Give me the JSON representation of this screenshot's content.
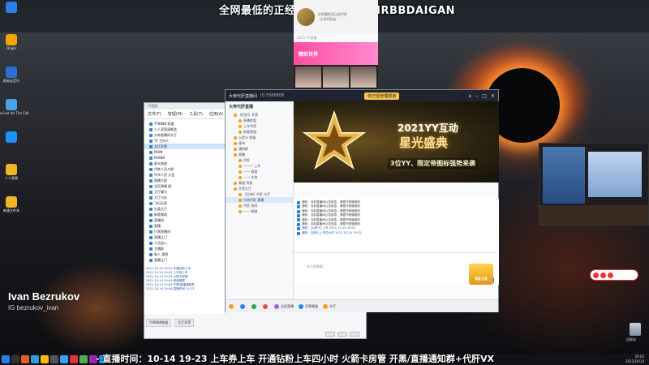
{
  "banner": {
    "text": "全网最低的正经代肝店：+VX MRBBDAIGAN"
  },
  "ticker": {
    "text": "- 直播时间：10-14 19-23 上车券上车 开通钻粉上车四小时 火箭卡房管 开黑/直播通知群+代肝VX"
  },
  "presenter": {
    "name": "Ivan Bezrukov",
    "handle": "IG bezrukov_ivan"
  },
  "desktop_icons": [
    {
      "label": "",
      "color": "#2b7de9",
      "icon": "app-icon"
    },
    {
      "label": "Origin",
      "color": "#f4a300",
      "icon": "folder-icon"
    },
    {
      "label": "网易云音乐",
      "color": "#2d6fd0",
      "icon": "app-icon"
    },
    {
      "label": "Love-Live for The Call",
      "color": "#4aa3e8",
      "icon": "app-icon"
    },
    {
      "label": "",
      "color": "#1e90ff",
      "icon": "globe-icon"
    },
    {
      "label": "人人视频",
      "color": "#f0b429",
      "icon": "folder-icon"
    },
    {
      "label": "新建文件夹",
      "color": "#f0b429",
      "icon": "folder-icon"
    }
  ],
  "phone": {
    "header_line1": "全网最低的正经代肝",
    "header_line2": "· 正经代肝店",
    "sub": "2021 YY直播",
    "promo": "精彩世界"
  },
  "qq": {
    "title": "YY团队",
    "menu": [
      "文件(F)",
      "管理(M)",
      "工具(T)",
      "应用(A)",
      "帮助(H)"
    ],
    "tree": [
      {
        "label": "YY8888 频道",
        "sel": false
      },
      {
        "label": "人人家园演唱会",
        "sel": false
      },
      {
        "label": "大帝直播间大厅",
        "sel": false
      },
      {
        "label": "YY 主持人",
        "sel": false
      },
      {
        "label": "大厅开黑",
        "sel": true
      },
      {
        "label": "MAIN",
        "sel": false
      },
      {
        "label": "MAINB",
        "sel": false
      },
      {
        "label": "星光频道",
        "sel": false
      },
      {
        "label": "代练人员大群",
        "sel": false
      },
      {
        "label": "中华人民 大会",
        "sel": false
      },
      {
        "label": "直播大群",
        "sel": false
      },
      {
        "label": "全民演唱 群",
        "sel": false
      },
      {
        "label": "大厅聊天",
        "sel": false
      },
      {
        "label": "大厅讨论",
        "sel": false
      },
      {
        "label": "飞行玩家",
        "sel": false
      },
      {
        "label": "分类大厅",
        "sel": false
      },
      {
        "label": "新版频道",
        "sel": false
      },
      {
        "label": "直播间",
        "sel": false
      },
      {
        "label": "直播",
        "sel": false
      },
      {
        "label": "日常直播间",
        "sel": false
      },
      {
        "label": "直播之门",
        "sel": false
      },
      {
        "label": "人员加入",
        "sel": false
      },
      {
        "label": "主播群",
        "sel": false
      },
      {
        "label": "新人 报到",
        "sel": false
      },
      {
        "label": "直播之门",
        "sel": false
      }
    ],
    "log": [
      "2021-10-14 19:01  开通钻粉上车 ",
      "2021-10-14 19:02  上车券上车 ",
      "2021-10-14 19:03  火箭卡房管 ",
      "2021-10-14 19:04  频道管理 ",
      "2021-10-14 19:05  开黑/直播通知群 ",
      "2021-10-14 19:06  直播时间 19-23"
    ],
    "tabs": [
      "YY8888频道",
      "大厅开黑"
    ]
  },
  "yy": {
    "title": "大帝代肝直播间",
    "channel": "ID 5588808",
    "hot_label": "你已经管理频道",
    "channel_tree_title": "大帝代肝直播",
    "channel_tree": [
      {
        "label": "【代肝】开黑",
        "sub": false,
        "sel": false
      },
      {
        "label": "直播房管",
        "sub": true,
        "sel": false
      },
      {
        "label": "上车专用",
        "sub": true,
        "sel": false
      },
      {
        "label": "房管频道",
        "sub": true,
        "sel": false
      },
      {
        "label": "火箭卡 频道",
        "sub": false,
        "sel": false
      },
      {
        "label": "接待",
        "sub": false,
        "sel": false
      },
      {
        "label": "通知群",
        "sub": false,
        "sel": false
      },
      {
        "label": "直播",
        "sub": false,
        "sel": false
      },
      {
        "label": "代肝",
        "sub": true,
        "sel": false
      },
      {
        "label": "一一一 上车",
        "sub": true,
        "sel": false
      },
      {
        "label": "—— 频道",
        "sub": true,
        "sel": false
      },
      {
        "label": "—— 主持",
        "sub": true,
        "sel": false
      },
      {
        "label": "频道 列表",
        "sub": false,
        "sel": false
      },
      {
        "label": "开黑大厅",
        "sub": false,
        "sel": false
      },
      {
        "label": "【大帝】代肝 大厅",
        "sub": true,
        "sel": false
      },
      {
        "label": "大帝代肝 直播",
        "sub": true,
        "sel": true
      },
      {
        "label": "代肝 房间",
        "sub": true,
        "sel": false
      },
      {
        "label": "—— 频道",
        "sub": true,
        "sel": false
      }
    ],
    "stage": {
      "line1": "2021YY互动",
      "line2": "星光盛典",
      "line3": "3位YY、限定帝图标强势来袭"
    },
    "chat": [
      {
        "text": "通知：当前直播间公告信息，请遵守频道规则",
        "blue": false
      },
      {
        "text": "通知：当前直播间公告信息，请遵守频道规则",
        "blue": false
      },
      {
        "text": "通知：当前直播间公告信息，请遵守频道规则",
        "blue": false
      },
      {
        "text": "通知：当前直播间公告信息，请遵守频道规则",
        "blue": false
      },
      {
        "text": "通知：当前直播间公告信息，请遵守频道规则",
        "blue": false
      },
      {
        "text": "通知：当前直播间公告信息，请遵守频道规则",
        "blue": false
      },
      {
        "text": "通知：[火箭卡] 上车 2021-10-14 19:01",
        "blue": true
      },
      {
        "text": "通知：[钻粉] 上车四小时 2021-10-14 19:02",
        "blue": true
      }
    ],
    "input_placeholder": "和大家聊聊...",
    "send_label": "发送",
    "badge_label": "领取大奖",
    "bottom": [
      {
        "label": "",
        "color": "#f0a020"
      },
      {
        "label": "",
        "color": "#2c83ea"
      },
      {
        "label": "",
        "color": "#22aa55"
      },
      {
        "label": "",
        "color": "#e05050"
      },
      {
        "label": "全民直播",
        "color": "#a060e0"
      },
      {
        "label": "开黑频道",
        "color": "#2c83ea"
      },
      {
        "label": "大厅",
        "color": "#f0a020"
      }
    ]
  },
  "recycle_label": "回收站",
  "taskbar_icons": [
    "#2b7de9",
    "#333",
    "#e06020",
    "#2d9cdb",
    "#ffbb00",
    "#555",
    "#3aa0ff",
    "#d33",
    "#4caf50",
    "#9c27b0",
    "#2196f3"
  ],
  "clock": {
    "time": "20:02",
    "date": "2021/10/14"
  }
}
